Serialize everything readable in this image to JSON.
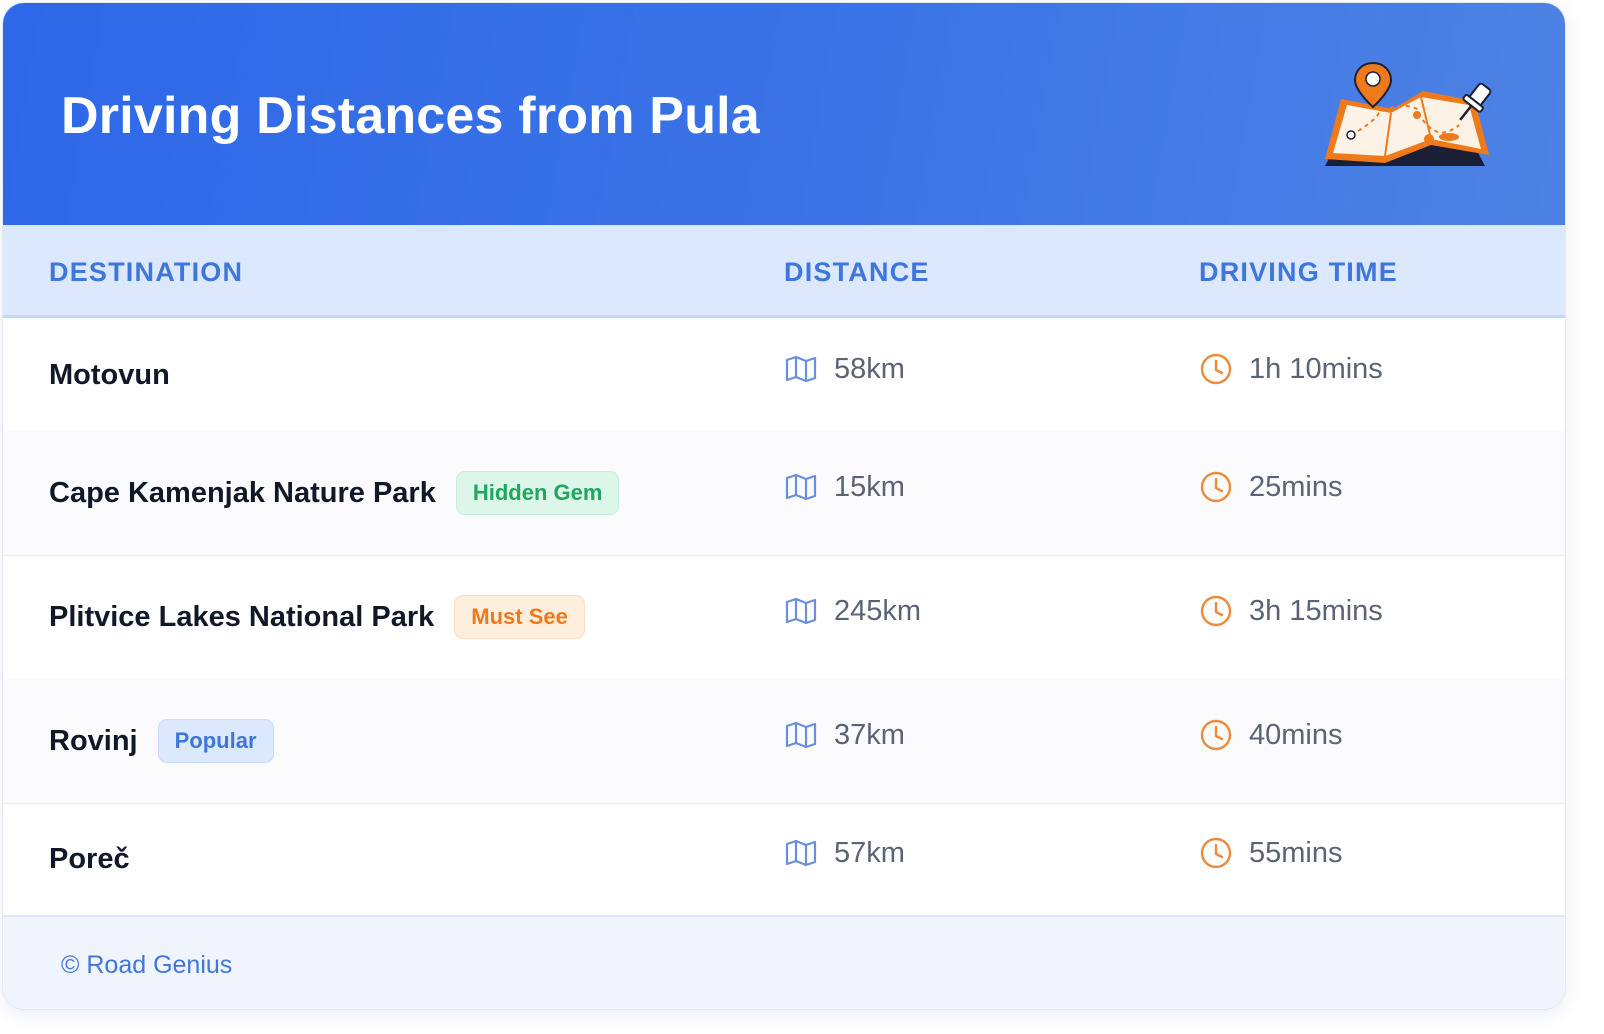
{
  "header": {
    "title": "Driving Distances from Pula",
    "illustration_icon": "map-with-pins-icon"
  },
  "table": {
    "columns": [
      "DESTINATION",
      "DISTANCE",
      "DRIVING TIME"
    ],
    "rows": [
      {
        "destination": "Motovun",
        "badge": null,
        "distance": "58km",
        "time": "1h 10mins"
      },
      {
        "destination": "Cape Kamenjak Nature Park",
        "badge": {
          "label": "Hidden Gem",
          "color": "green"
        },
        "distance": "15km",
        "time": "25mins"
      },
      {
        "destination": "Plitvice Lakes National Park",
        "badge": {
          "label": "Must See",
          "color": "orange"
        },
        "distance": "245km",
        "time": "3h 15mins"
      },
      {
        "destination": "Rovinj",
        "badge": {
          "label": "Popular",
          "color": "blue"
        },
        "distance": "37km",
        "time": "40mins"
      },
      {
        "destination": "Poreč",
        "badge": null,
        "distance": "57km",
        "time": "55mins"
      }
    ],
    "distance_icon": "map-icon",
    "time_icon": "clock-icon"
  },
  "footer": {
    "credit": "© Road Genius"
  },
  "colors": {
    "header_gradient_start": "#2e68e8",
    "header_gradient_end": "#4d82e4",
    "accent_blue": "#3f76dc",
    "accent_orange": "#ee7a1c",
    "accent_green": "#21a55f",
    "table_header_bg": "#dbe8fd"
  }
}
